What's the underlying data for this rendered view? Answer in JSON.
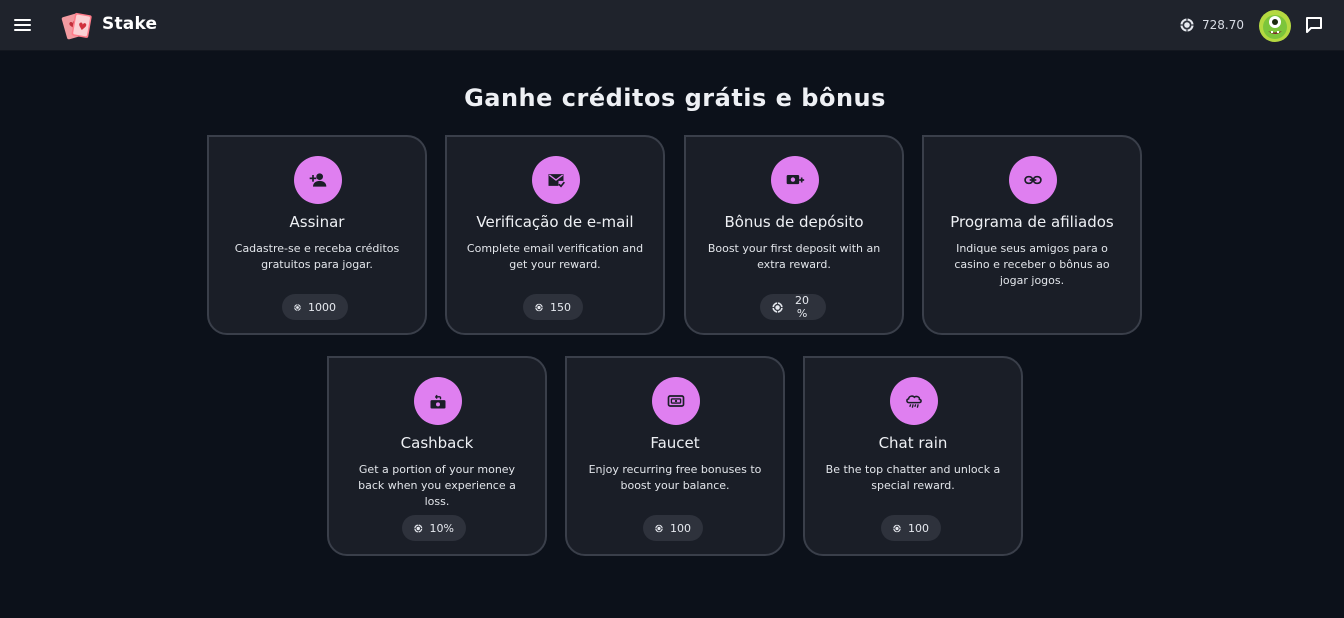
{
  "header": {
    "brand": "Stake",
    "balance": "728.70",
    "icons": {
      "menu": "hamburger-menu-icon",
      "logo": "playing-cards-logo",
      "coin": "coin-icon",
      "avatar": "green-monster-avatar",
      "chat": "chat-bubble-icon"
    }
  },
  "page": {
    "title": "Ganhe créditos grátis e bônus"
  },
  "colors": {
    "background": "#0c111a",
    "header": "#1f232c",
    "card": "#1a1e27",
    "card_border": "#3a3f4a",
    "accent_icon_bg": "#df7ff0",
    "reward_pill": "#2e323c"
  },
  "cards": [
    {
      "title": "Assinar",
      "description": "Cadastre-se e receba créditos gratuitos para jogar.",
      "reward": "1000",
      "icon": "add-user-icon"
    },
    {
      "title": "Verificação de e-mail",
      "description": "Complete email verification and get your reward.",
      "reward": "150",
      "icon": "mail-check-icon"
    },
    {
      "title": "Bônus de depósito",
      "description": "Boost your first deposit with an extra reward.",
      "reward": "20 %",
      "icon": "money-plus-icon"
    },
    {
      "title": "Programa de afiliados",
      "description": "Indique seus amigos para o casino e receber o bônus ao jogar jogos.",
      "reward": "",
      "icon": "link-icon"
    },
    {
      "title": "Cashback",
      "description": "Get a portion of your money back when you experience a loss.",
      "reward": "10%",
      "icon": "cashback-icon"
    },
    {
      "title": "Faucet",
      "description": "Enjoy recurring free bonuses to boost your balance.",
      "reward": "100",
      "icon": "banknote-icon"
    },
    {
      "title": "Chat rain",
      "description": "Be the top chatter and unlock a special reward.",
      "reward": "100",
      "icon": "cloud-rain-icon"
    }
  ]
}
